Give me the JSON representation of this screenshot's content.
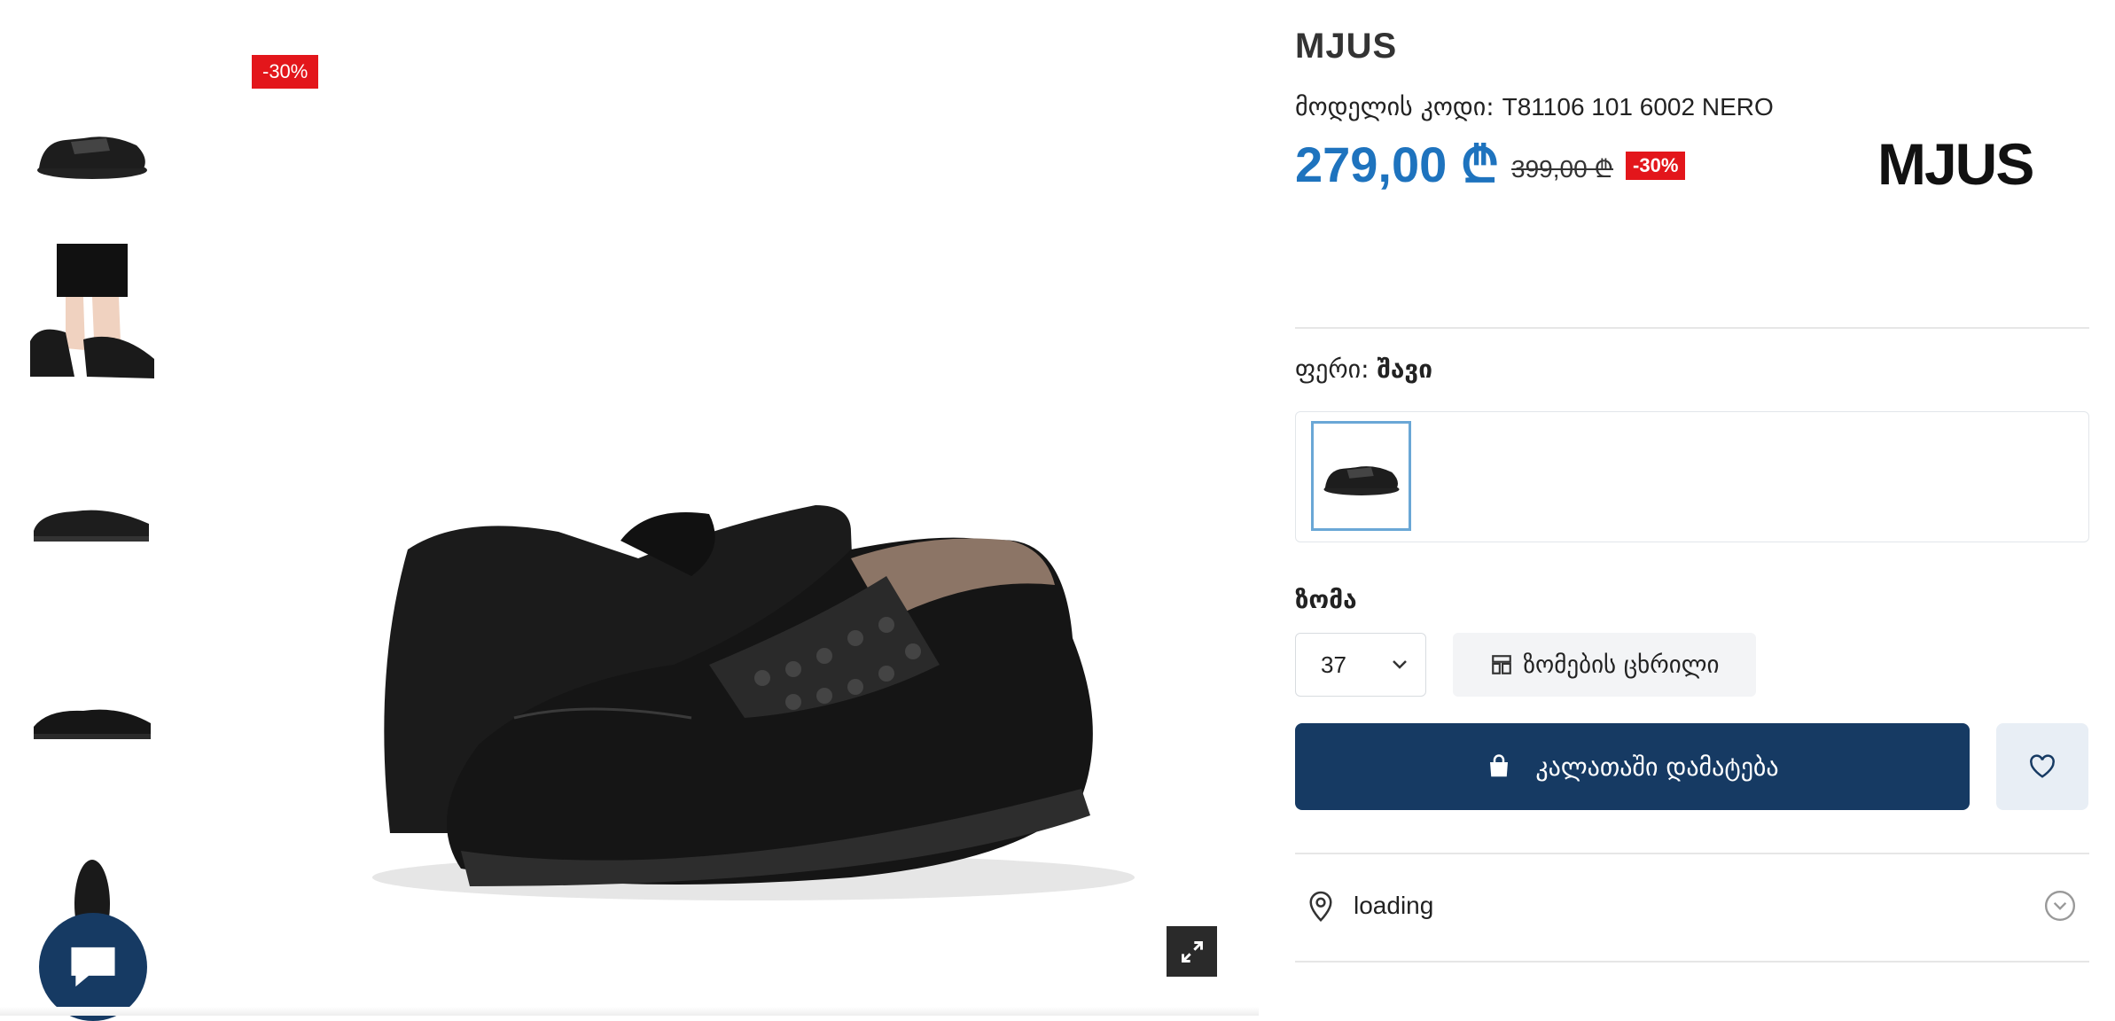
{
  "product": {
    "brand": "MJUS",
    "model_code_label": "მოდელის კოდი:",
    "model_code": "T81106 101 6002 NERO",
    "price_current": "279,00 ₾",
    "price_old": "399,00 ₾",
    "discount": "-30%",
    "brand_logo_text": "MJUS"
  },
  "gallery": {
    "discount_badge": "-30%",
    "thumbnails": [
      "thumb-1",
      "thumb-2",
      "thumb-3",
      "thumb-4",
      "thumb-5"
    ]
  },
  "color": {
    "label": "ფერი:",
    "value": "შავი"
  },
  "size": {
    "label": "ზომა",
    "selected": "37",
    "size_chart_label": "ზომების ცხრილი"
  },
  "actions": {
    "add_to_cart": "კალათაში დამატება"
  },
  "store_location": {
    "text": "loading"
  },
  "colors": {
    "accent_blue": "#1e73be",
    "navy": "#163a63",
    "discount_red": "#e3161b"
  },
  "icons": [
    "expand-icon",
    "chat-icon",
    "bag-icon",
    "heart-icon",
    "size-chart-icon",
    "location-pin-icon",
    "chevron-down-icon"
  ]
}
